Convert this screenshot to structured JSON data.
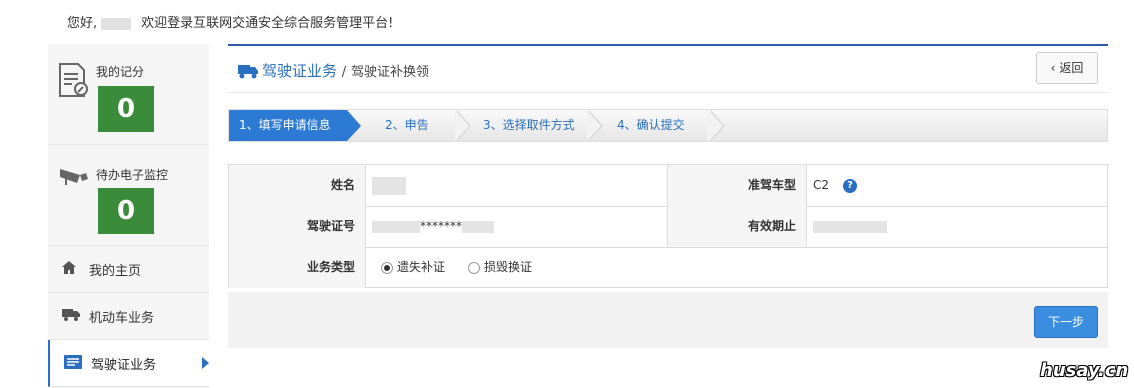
{
  "header": {
    "greeting": "您好,",
    "welcome": "欢迎登录互联网交通安全综合服务管理平台!"
  },
  "sidebar": {
    "cards": [
      {
        "label": "我的记分",
        "value": "0",
        "icon": "document-edit-icon"
      },
      {
        "label": "待办电子监控",
        "value": "0",
        "icon": "surveillance-camera-icon"
      }
    ],
    "items": [
      {
        "label": "我的主页",
        "icon": "home-icon"
      },
      {
        "label": "机动车业务",
        "icon": "truck-icon"
      },
      {
        "label": "驾驶证业务",
        "icon": "license-card-icon"
      }
    ]
  },
  "page": {
    "title": "驾驶证业务",
    "separator": "/",
    "subtitle": "驾驶证补换领",
    "back_label": "返回"
  },
  "steps": [
    "1、填写申请信息",
    "2、申告",
    "3、选择取件方式",
    "4、确认提交"
  ],
  "form": {
    "name_label": "姓名",
    "class_label": "准驾车型",
    "class_value": "C2",
    "license_label": "驾驶证号",
    "license_masked": "*******",
    "expiry_label": "有效期止",
    "type_label": "业务类型",
    "options": [
      "遗失补证",
      "损毁换证"
    ],
    "selected_option": "遗失补证"
  },
  "footer": {
    "next_label": "下一步"
  },
  "watermark": "husay.cn",
  "colors": {
    "accent": "#2a6fbf",
    "score_green": "#3a8b3a",
    "step_active": "#2d7ad5"
  }
}
